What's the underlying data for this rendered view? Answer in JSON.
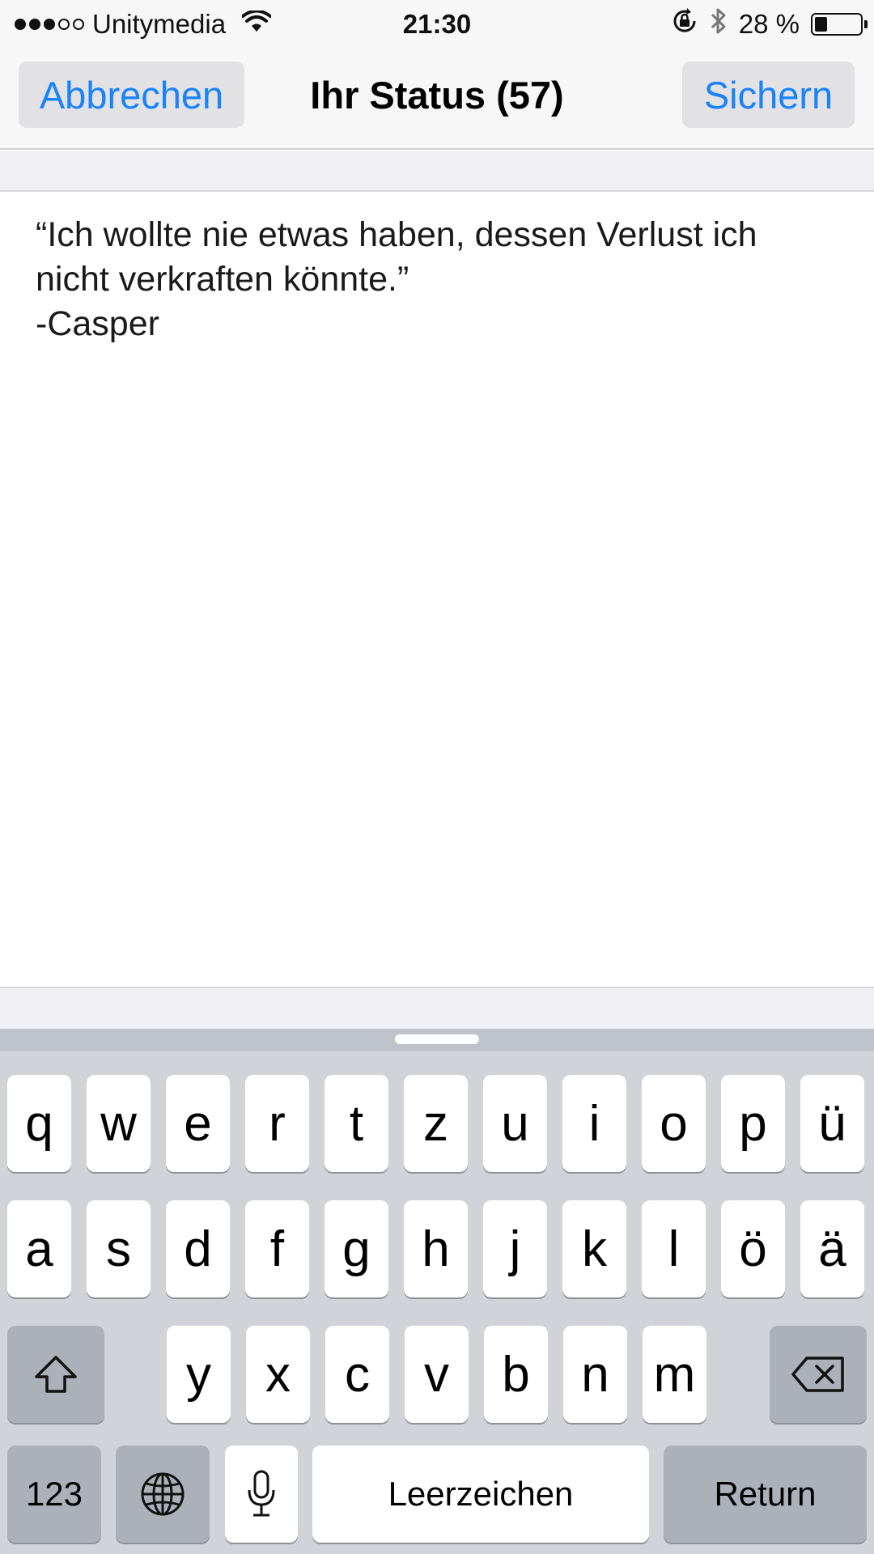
{
  "status_bar": {
    "signal_bars_filled": 3,
    "signal_bars_total": 5,
    "carrier": "Unitymedia",
    "time": "21:30",
    "battery_percent": "28 %",
    "battery_level": 0.28,
    "icons": [
      "wifi-icon",
      "rotation-lock-icon",
      "bluetooth-icon",
      "battery-icon"
    ]
  },
  "nav": {
    "cancel_label": "Abbrechen",
    "title": "Ihr Status (57)",
    "save_label": "Sichern"
  },
  "editor": {
    "text": "“Ich wollte nie etwas haben, dessen Verlust ich nicht verkraften könnte.”\n-Casper"
  },
  "keyboard": {
    "row1": [
      "q",
      "w",
      "e",
      "r",
      "t",
      "z",
      "u",
      "i",
      "o",
      "p",
      "ü"
    ],
    "row2": [
      "a",
      "s",
      "d",
      "f",
      "g",
      "h",
      "j",
      "k",
      "l",
      "ö",
      "ä"
    ],
    "row3": [
      "y",
      "x",
      "c",
      "v",
      "b",
      "n",
      "m"
    ],
    "numbers_label": "123",
    "space_label": "Leerzeichen",
    "return_label": "Return",
    "icons": [
      "shift-icon",
      "backspace-icon",
      "globe-icon",
      "microphone-icon"
    ]
  },
  "colors": {
    "accent": "#1a82fb",
    "key_dark": "#acb0b8",
    "keyboard_bg": "#d1d3d9"
  }
}
